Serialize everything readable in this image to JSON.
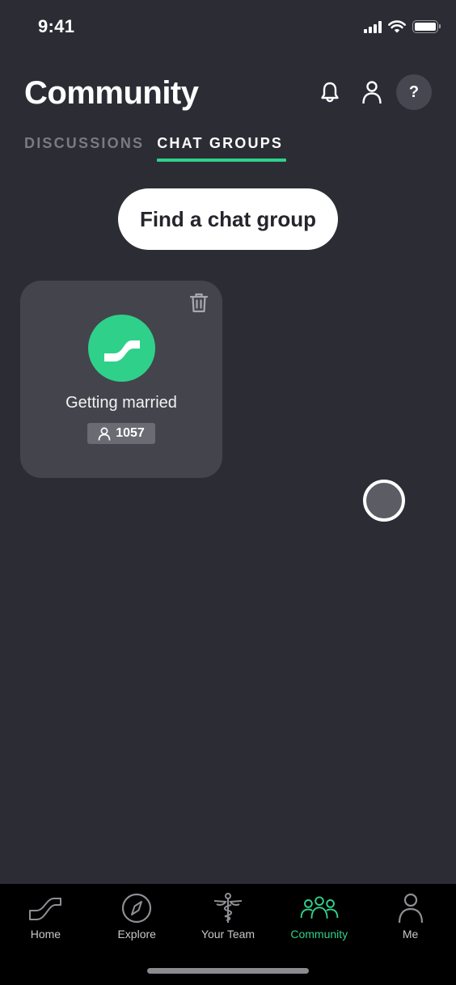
{
  "status_bar": {
    "time": "9:41",
    "icons": [
      "cellular-signal-icon",
      "wifi-icon",
      "battery-icon"
    ]
  },
  "header": {
    "title": "Community",
    "actions": [
      {
        "name": "notifications",
        "icon": "bell-icon"
      },
      {
        "name": "profile",
        "icon": "person-icon"
      },
      {
        "name": "help",
        "label": "?"
      }
    ]
  },
  "tabs": [
    {
      "label": "DISCUSSIONS",
      "active": false
    },
    {
      "label": "CHAT GROUPS",
      "active": true
    }
  ],
  "find_button": {
    "label": "Find a chat group"
  },
  "groups": [
    {
      "name": "Getting married",
      "members": "1057",
      "icon": "wave-logo-icon",
      "delete_icon": "trash-icon"
    }
  ],
  "tab_bar": {
    "items": [
      {
        "label": "Home",
        "icon": "home-wave-icon",
        "active": false
      },
      {
        "label": "Explore",
        "icon": "compass-icon",
        "active": false
      },
      {
        "label": "Your Team",
        "icon": "caduceus-icon",
        "active": false
      },
      {
        "label": "Community",
        "icon": "group-icon",
        "active": true
      },
      {
        "label": "Me",
        "icon": "person-icon",
        "active": false
      }
    ]
  },
  "colors": {
    "background": "#2c2c35",
    "accent": "#2fd18a",
    "card": "#44444c",
    "tab_bar": "#000000"
  }
}
